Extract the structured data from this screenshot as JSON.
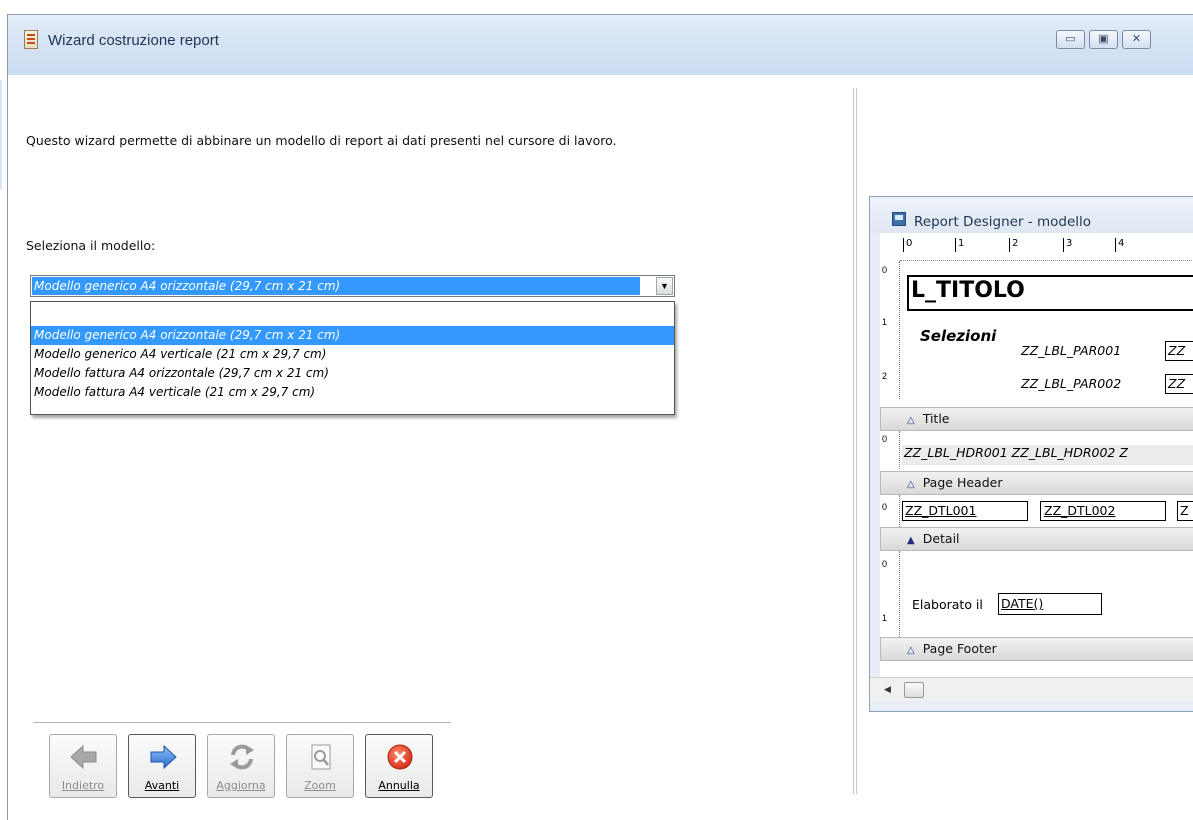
{
  "window": {
    "title": "Wizard costruzione report",
    "controls": {
      "minimize": "▭",
      "maximize": "▣",
      "close": "✕"
    }
  },
  "intro_text": "Questo wizard permette di abbinare un modello di report ai dati presenti nel cursore di lavoro.",
  "select": {
    "label": "Seleziona il modello:",
    "value": "Modello generico A4 orizzontale (29,7 cm x 21 cm)",
    "options": [
      "",
      "Modello generico A4 orizzontale (29,7 cm x 21 cm)",
      "Modello generico A4 verticale (21 cm x 29,7 cm)",
      "Modello fattura A4 orizzontale (29,7 cm x 21 cm)",
      "Modello fattura A4 verticale (21 cm x 29,7 cm)"
    ]
  },
  "buttons": {
    "back": "Indietro",
    "next": "Avanti",
    "refresh": "Aggiorna",
    "zoom": "Zoom",
    "cancel": "Annulla"
  },
  "preview": {
    "title": "Report Designer - modello",
    "ruler_ticks": [
      "0",
      "1",
      "2",
      "3",
      "4"
    ],
    "vruler_title": [
      "0",
      "1",
      "2"
    ],
    "title_label": "L_TITOLO",
    "selections_label": "Selezioni",
    "par1": "ZZ_LBL_PAR001",
    "par2": "ZZ_LBL_PAR002",
    "par_box": "ZZ",
    "band_title": "Title",
    "header_labels": "ZZ_LBL_HDR001 ZZ_LBL_HDR002 Z",
    "band_page_header": "Page Header",
    "dtl1": "ZZ_DTL001",
    "dtl2": "ZZ_DTL002",
    "dtl3": "Z",
    "band_detail": "Detail",
    "elaborated_label": "Elaborato il",
    "date_field": "DATE()",
    "band_page_footer": "Page Footer",
    "zero": "0",
    "one": "1"
  },
  "colors": {
    "selection": "#3399ff",
    "titlebar": "#d7e4f5",
    "band_detail_marker": "#2a3f8f"
  }
}
